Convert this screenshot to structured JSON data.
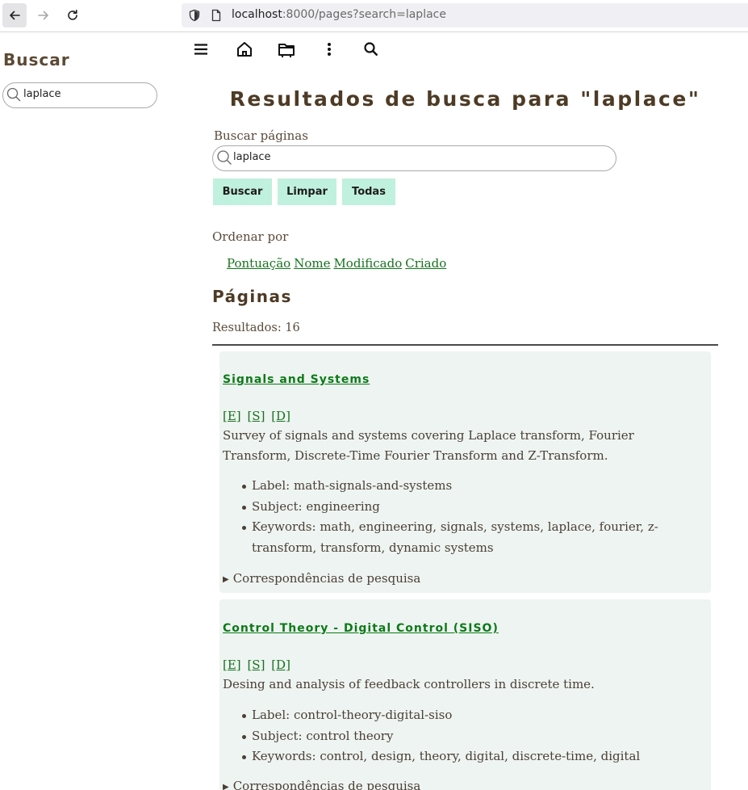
{
  "browser": {
    "url_host": "localhost",
    "url_rest": ":8000/pages?search=laplace"
  },
  "sidebar": {
    "title": "Buscar",
    "search_value": "laplace"
  },
  "toolbar": {
    "icons": [
      "menu-icon",
      "home-icon",
      "folder-icon",
      "more-vertical-icon",
      "search-icon"
    ]
  },
  "main": {
    "title": "Resultados de busca para \"laplace\"",
    "search_label": "Buscar páginas",
    "search_value": "laplace",
    "buttons": {
      "search": "Buscar",
      "clear": "Limpar",
      "all": "Todas"
    },
    "order_label": "Ordenar por",
    "order_options": [
      "Pontuação",
      "Nome",
      "Modificado",
      "Criado"
    ],
    "section_title": "Páginas",
    "results_count": "Resultados: 16"
  },
  "results": [
    {
      "title": "Signals and Systems",
      "links": [
        "[E]",
        "[S]",
        "[D]"
      ],
      "description": "Survey of signals and systems covering Laplace transform, Fourier Transform, Discrete-Time Fourier Transform and Z-Transform.",
      "meta": [
        "Label: math-signals-and-systems",
        "Subject: engineering",
        "Keywords: math, engineering, signals, systems, laplace, fourier, z-transform, transform, dynamic systems"
      ],
      "matches_label": "Correspondências de pesquisa"
    },
    {
      "title": "Control Theory - Digital Control (SISO)",
      "links": [
        "[E]",
        "[S]",
        "[D]"
      ],
      "description": "Desing and analysis of feedback controllers in discrete time.",
      "meta": [
        "Label: control-theory-digital-siso",
        "Subject: control theory",
        "Keywords: control, design, theory, digital, discrete-time, digital"
      ],
      "matches_label": "Correspondências de pesquisa"
    }
  ]
}
